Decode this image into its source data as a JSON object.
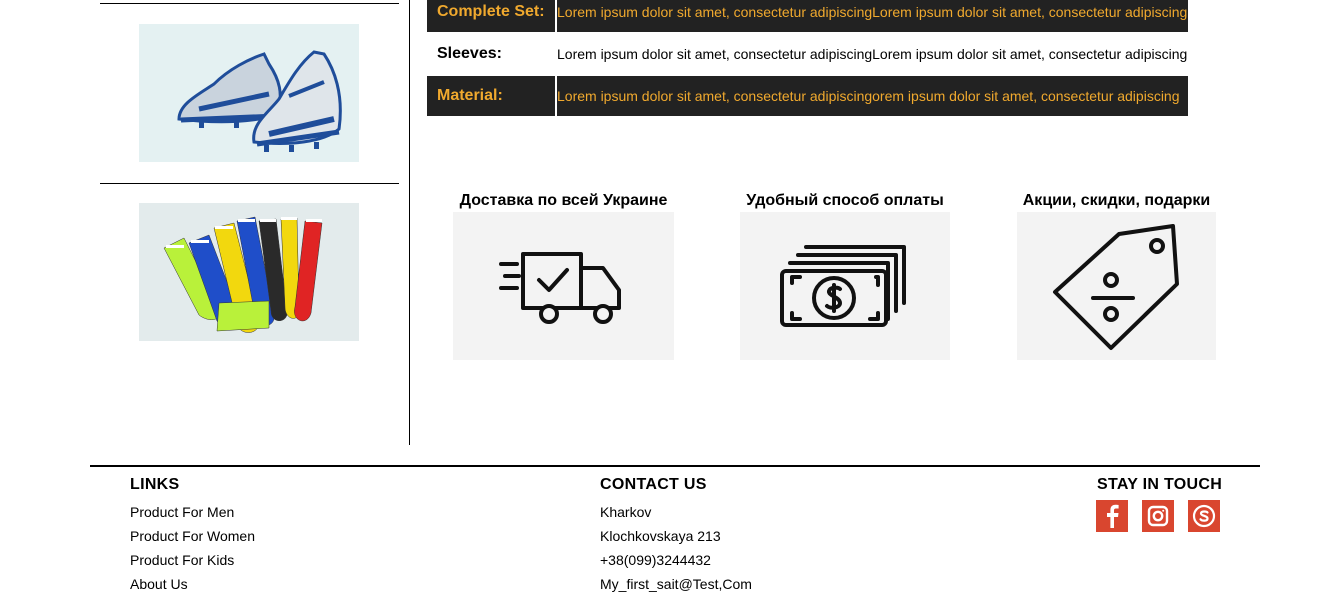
{
  "specs": [
    {
      "label": "Complete Set:",
      "value": "Lorem ipsum dolor sit amet, consectetur adipiscingLorem ipsum dolor sit amet, consectetur adipiscing",
      "style": "dark"
    },
    {
      "label": "Sleeves:",
      "value": "Lorem ipsum dolor sit amet, consectetur adipiscingLorem ipsum dolor sit amet, consectetur adipiscing",
      "style": "light"
    },
    {
      "label": "Material:",
      "value": "Lorem ipsum dolor sit amet, consectetur adipiscingorem ipsum dolor sit amet, consectetur adipiscing",
      "style": "dark"
    }
  ],
  "features": [
    {
      "title": "Доставка по всей Украине",
      "icon": "delivery-truck-icon"
    },
    {
      "title": "Удобный способ оплаты",
      "icon": "money-icon"
    },
    {
      "title": "Акции, скидки, подарки",
      "icon": "discount-tag-icon"
    }
  ],
  "sidebar_images": [
    "football-boots-image",
    "football-socks-image"
  ],
  "footer": {
    "links": {
      "heading": "LINKS",
      "items": [
        "Product For Men",
        "Product For Women",
        "Product For Kids",
        "About Us"
      ]
    },
    "contact": {
      "heading": "CONTACT US",
      "items": [
        "Kharkov",
        "Klochkovskaya 213",
        "+38(099)3244432",
        "My_first_sait@Test,Com"
      ]
    },
    "social": {
      "heading": "STAY IN TOUCH",
      "icons": [
        "facebook-icon",
        "instagram-icon",
        "skype-icon"
      ]
    }
  },
  "colors": {
    "accent": "#f0a92e",
    "dark_row": "#222222",
    "social": "#d9462f",
    "feature_bg": "#f3f3f3"
  }
}
